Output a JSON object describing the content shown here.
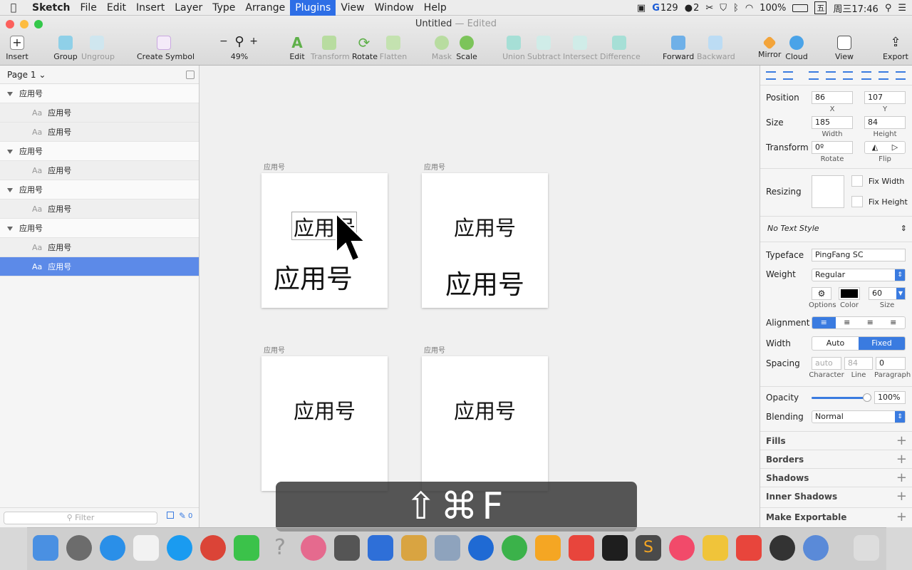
{
  "menubar": {
    "app_name": "Sketch",
    "items": [
      "File",
      "Edit",
      "Insert",
      "Layer",
      "Type",
      "Arrange",
      "Plugins",
      "View",
      "Window",
      "Help"
    ],
    "active_item": "Plugins",
    "status": {
      "badge_count": "129",
      "wechat_count": "2",
      "battery": "100%",
      "input_method": "五",
      "clock": "周三17:46"
    }
  },
  "window": {
    "title": "Untitled",
    "edited": "— Edited"
  },
  "toolbar": {
    "insert": "Insert",
    "group": "Group",
    "ungroup": "Ungroup",
    "create_symbol": "Create Symbol",
    "zoom_minus": "−",
    "zoom_plus": "+",
    "zoom": "49%",
    "edit": "Edit",
    "transform": "Transform",
    "rotate": "Rotate",
    "flatten": "Flatten",
    "mask": "Mask",
    "scale": "Scale",
    "union": "Union",
    "subtract": "Subtract",
    "intersect": "Intersect",
    "difference": "Difference",
    "forward": "Forward",
    "backward": "Backward",
    "mirror": "Mirror",
    "cloud": "Cloud",
    "view": "View",
    "export": "Export"
  },
  "layers": {
    "page": "Page 1",
    "items": [
      {
        "type": "group",
        "name": "应用号"
      },
      {
        "type": "text",
        "icon": "Aa",
        "name": "应用号"
      },
      {
        "type": "text",
        "icon": "Aa",
        "name": "应用号"
      },
      {
        "type": "group",
        "name": "应用号"
      },
      {
        "type": "text",
        "icon": "Aa",
        "name": "应用号"
      },
      {
        "type": "group",
        "name": "应用号"
      },
      {
        "type": "text",
        "icon": "Aa",
        "name": "应用号"
      },
      {
        "type": "group",
        "name": "应用号"
      },
      {
        "type": "text",
        "icon": "Aa",
        "name": "应用号"
      },
      {
        "type": "text",
        "icon": "Aa",
        "name": "应用号",
        "selected": true
      }
    ],
    "filter_placeholder": "Filter",
    "filter_count": "0"
  },
  "canvas": {
    "artboards": [
      {
        "label": "应用号",
        "texts": [
          "应用号",
          "应用号"
        ]
      },
      {
        "label": "应用号",
        "texts": [
          "应用号",
          "应用号"
        ]
      },
      {
        "label": "应用号",
        "texts": [
          "应用号"
        ]
      },
      {
        "label": "应用号",
        "texts": [
          "应用号"
        ]
      }
    ],
    "shortcut_hud": "⇧⌘F"
  },
  "inspector": {
    "position": {
      "label": "Position",
      "x": "86",
      "y": "107",
      "x_label": "X",
      "y_label": "Y"
    },
    "size": {
      "label": "Size",
      "width": "185",
      "height": "84",
      "w_label": "Width",
      "h_label": "Height"
    },
    "transform": {
      "label": "Transform",
      "rotate": "0º",
      "rotate_label": "Rotate",
      "flip_label": "Flip"
    },
    "resizing": {
      "label": "Resizing",
      "fix_width": "Fix Width",
      "fix_height": "Fix Height"
    },
    "text_style": "No Text Style",
    "typeface": {
      "label": "Typeface",
      "value": "PingFang SC"
    },
    "weight": {
      "label": "Weight",
      "value": "Regular"
    },
    "options_label": "Options",
    "color_label": "Color",
    "size_label": "Size",
    "font_size": "60",
    "text_color": "#000000",
    "alignment_label": "Alignment",
    "width_label": "Width",
    "width_auto": "Auto",
    "width_fixed": "Fixed",
    "spacing": {
      "label": "Spacing",
      "character": "auto",
      "line": "84",
      "paragraph": "0",
      "character_label": "Character",
      "line_label": "Line",
      "paragraph_label": "Paragraph"
    },
    "opacity": {
      "label": "Opacity",
      "value": "100%",
      "level": 1.0
    },
    "blending": {
      "label": "Blending",
      "value": "Normal"
    },
    "sections": [
      "Fills",
      "Borders",
      "Shadows",
      "Inner Shadows",
      "Make Exportable"
    ]
  },
  "colors": {
    "accent": "#2d6ee6",
    "selection": "#5c8ae8"
  }
}
